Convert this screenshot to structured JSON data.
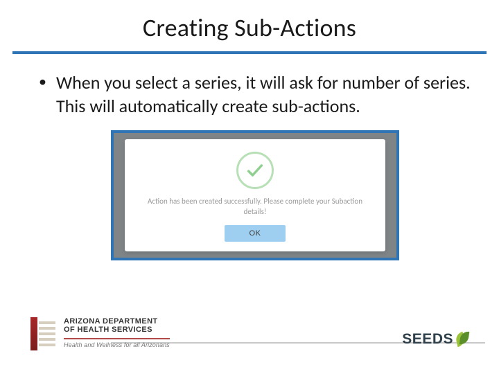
{
  "title": "Creating Sub-Actions",
  "bullet": "When you select a series, it will ask for number of series. This will automatically create sub-actions.",
  "dialog": {
    "message": "Action has been created successfully. Please complete your Subaction details!",
    "ok_label": "OK"
  },
  "footer": {
    "agency_line1": "ARIZONA DEPARTMENT",
    "agency_line2": "OF HEALTH SERVICES",
    "tagline": "Health and Wellness for all Arizonans",
    "brand": "SEEDS"
  }
}
